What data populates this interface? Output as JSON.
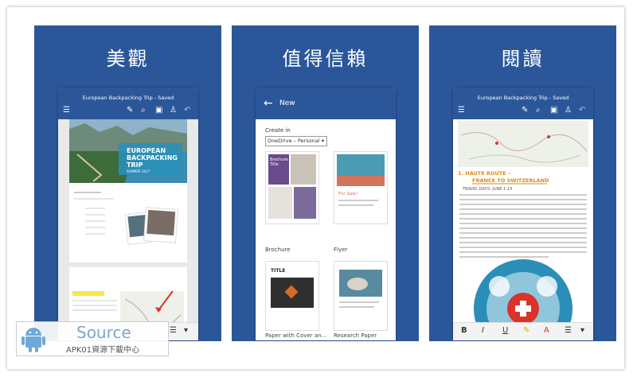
{
  "panels": [
    {
      "title": "美觀",
      "doc_title": "European Backpacking Trip - Saved"
    },
    {
      "title": "值得信賴",
      "new_label": "New",
      "create_in": "Create in",
      "location": "OneDrive – Personal",
      "templates": [
        "Brochure",
        "Flyer",
        "Paper with Cover an...",
        "Research Paper"
      ],
      "brochure_text": "Brochure Title",
      "flyer_text": "For Sale!",
      "paper_text": "TITLE"
    },
    {
      "title": "閱讀",
      "doc_title": "European Backpacking Trip - Saved",
      "heading1": "1. HAUTE ROUTE –",
      "heading2": "FRANCE TO SWITZERLAND",
      "travel_days": "TRAVEL DAYS: JUNE 1-15"
    }
  ],
  "doc1": {
    "cover_title_1": "EUROPEAN",
    "cover_title_2": "BACKPACKING",
    "cover_title_3": "TRIP",
    "cover_sub": "SUMMER 2017"
  },
  "watermark": {
    "source": "Source",
    "sub": "APK01資源下載中心"
  },
  "colors": {
    "brand": "#2b579a",
    "accent_red": "#d9332b",
    "teal": "#2a8fb8",
    "highlight": "#f5e84a"
  }
}
